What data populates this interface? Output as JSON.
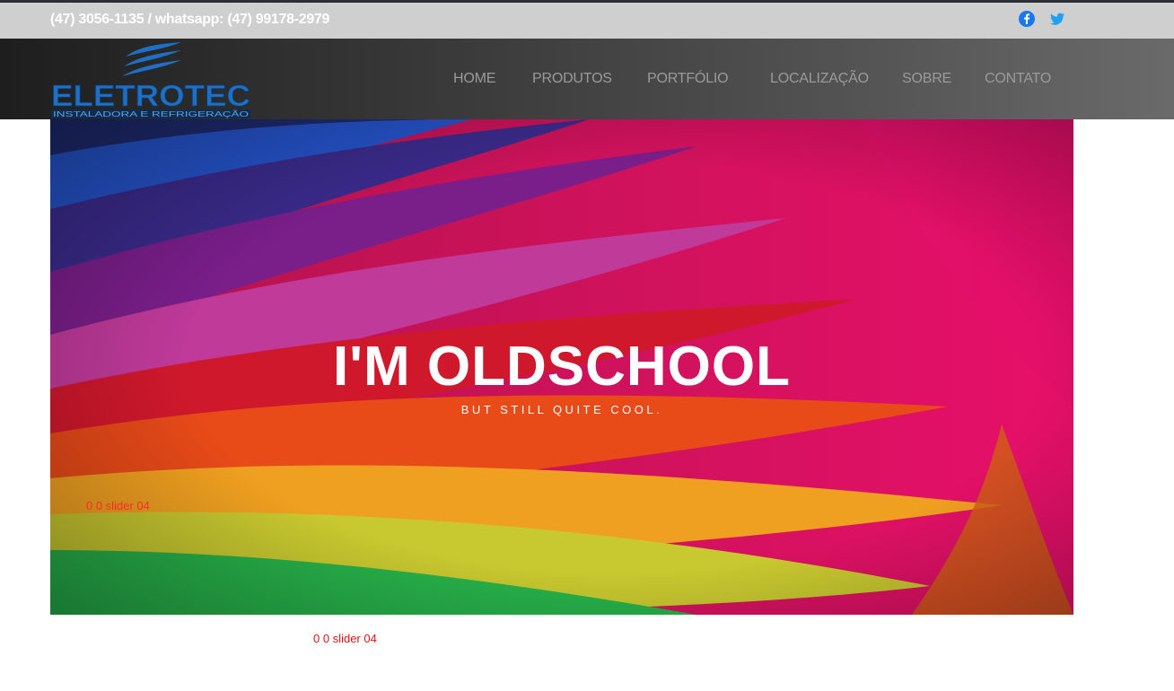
{
  "topbar": {
    "contact_text": "(47) 3056-1135 / whatsapp: (47) 99178-2979",
    "social_icons": [
      "facebook-icon",
      "twitter-icon"
    ],
    "facebook_color": "#1877f2",
    "twitter_color": "#1da1f2"
  },
  "header": {
    "logo_text": "ELETROTEC",
    "logo_tagline": "INSTALADORA E REFRIGERAÇÃO",
    "logo_color": "#1f6fc4",
    "nav": [
      {
        "label": "HOME"
      },
      {
        "label": "PRODUTOS"
      },
      {
        "label": "PORTFÓLIO"
      },
      {
        "label": "LOCALIZAÇÃO"
      },
      {
        "label": "SOBRE"
      },
      {
        "label": "CONTATO"
      }
    ]
  },
  "hero": {
    "title": "I'M OLDSCHOOL",
    "subtitle": "BUT STILL QUITE COOL.",
    "slider_label": "0 0 slider 04"
  },
  "below_hero": {
    "slider_label": "0 0 slider 04"
  }
}
